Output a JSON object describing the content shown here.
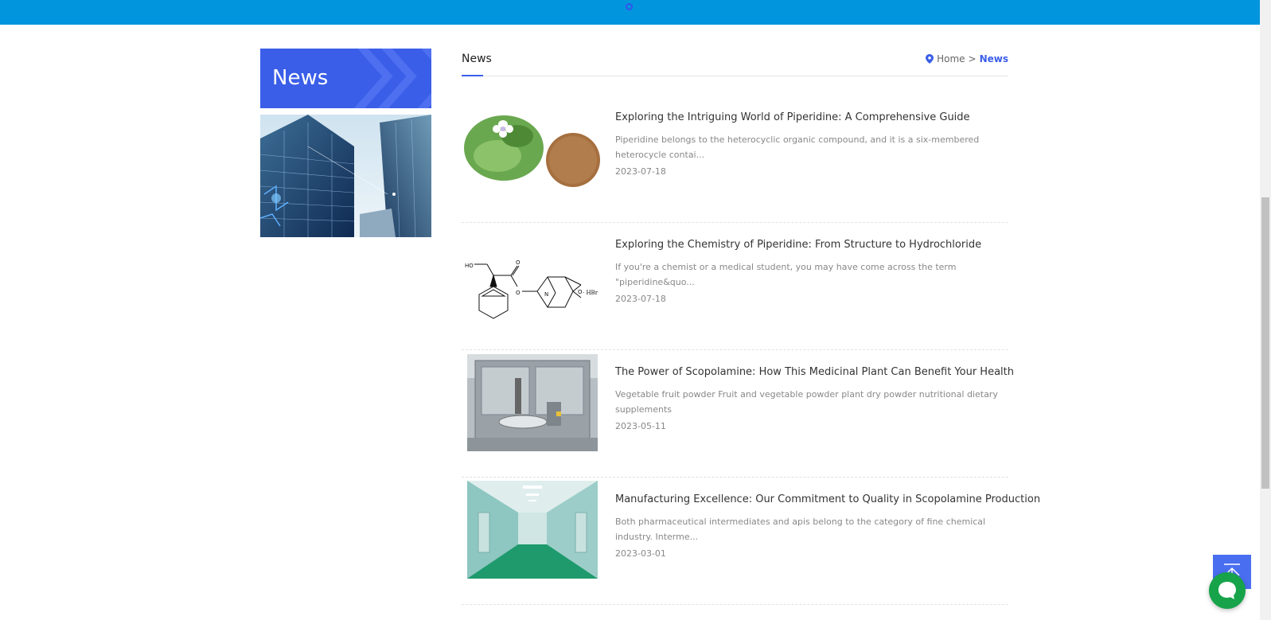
{
  "sidebar": {
    "title": "News"
  },
  "main": {
    "heading": "News",
    "breadcrumb": {
      "home": "Home",
      "separator": ">",
      "current": "News"
    }
  },
  "news": [
    {
      "title": "Exploring the Intriguing World of Piperidine: A Comprehensive Guide",
      "summary": "Piperidine belongs to the heterocyclic organic compound, and it is a six-membered heterocycle contai...",
      "date": "2023-07-18"
    },
    {
      "title": "Exploring the Chemistry of Piperidine: From Structure to Hydrochloride",
      "summary": "If you're a chemist or a medical student, you may have come across the term \"piperidine&quo...",
      "date": "2023-07-18"
    },
    {
      "title": "The Power of Scopolamine: How This Medicinal Plant Can Benefit Your Health",
      "summary": "Vegetable fruit powder Fruit and vegetable powder plant dry powder nutritional dietary supplements",
      "date": "2023-05-11"
    },
    {
      "title": "Manufacturing Excellence: Our Commitment to Quality in Scopolamine Production",
      "summary": "Both pharmaceutical intermediates and apis belong to the category of fine chemical industry. Interme...",
      "date": "2023-03-01"
    }
  ],
  "molecule": {
    "ho": "HO",
    "o_label": "O",
    "n_label": "N",
    "hbr": "· HBr"
  },
  "colors": {
    "topbar": "#0095dd",
    "accent": "#3a5ee8",
    "chat": "#17a34a"
  },
  "icons": {
    "breadcrumb": "location-pin-icon",
    "back_to_top": "arrow-up-icon",
    "chat": "chat-bubble-icon"
  }
}
